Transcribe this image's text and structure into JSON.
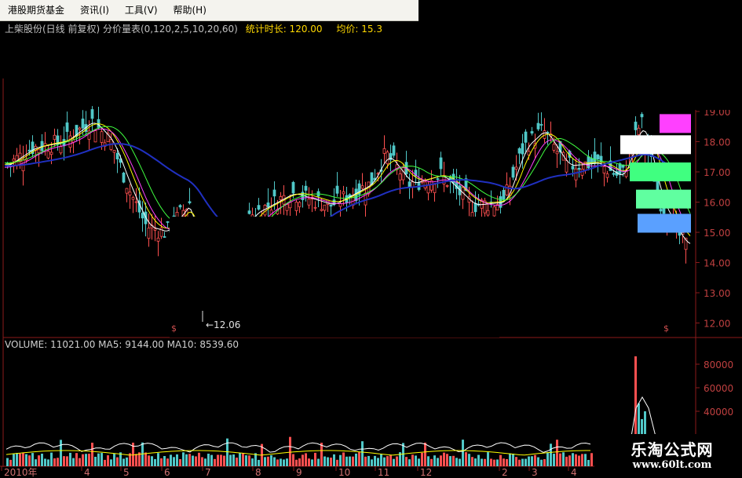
{
  "menu": [
    {
      "label": "港股期货基金"
    },
    {
      "label": "资讯(I)"
    },
    {
      "label": "工具(V)"
    },
    {
      "label": "帮助(H)"
    }
  ],
  "info": {
    "title": "上柴股份(日线 前复权) 分价量表(0,120,2,5,10,20,60)",
    "stat": "统计时长: 120.00",
    "avg": "均价: 15.3"
  },
  "volume_label": "VOLUME: 11021.00  MA5: 9144.00  MA10: 8539.60",
  "low_label": "←12.06",
  "price_ticks": [
    "19.00",
    "18.00",
    "17.00",
    "16.00",
    "15.00",
    "14.00",
    "13.00",
    "12.00"
  ],
  "vol_ticks": [
    "80000",
    "60000",
    "40000"
  ],
  "month_labels": [
    "2010年",
    "4",
    "5",
    "6",
    "7",
    "8",
    "9",
    "10",
    "11",
    "12",
    "2",
    "3",
    "4"
  ],
  "watermark": {
    "title": "乐淘公式网",
    "url": "www.60lt.com"
  },
  "colors": {
    "up": "#ff5050",
    "down": "#50c8c8",
    "ma_white": "#ffffff",
    "ma_yellow": "#ffff00",
    "ma_purple": "#ff40ff",
    "ma_green": "#40ff40",
    "ma_blue": "#2030c0",
    "grid": "#8b1a1a"
  },
  "profile_bars": [
    {
      "color": "#ff40ff",
      "price": 18.6
    },
    {
      "color": "#ffffff",
      "price": 17.9
    },
    {
      "color": "#40ff80",
      "price": 17.0
    },
    {
      "color": "#60ffa0",
      "price": 16.1
    },
    {
      "color": "#5aa0ff",
      "price": 15.3
    }
  ]
}
